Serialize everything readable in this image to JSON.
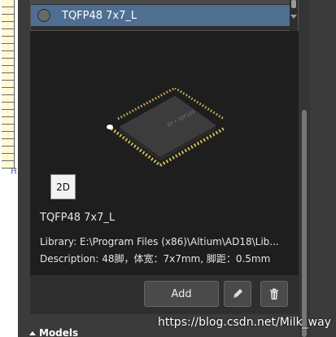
{
  "component_list": {
    "selected_item": "TQFP48 7x7_L"
  },
  "preview": {
    "view_mode_button": "2D",
    "component_name": "TQFP48 7x7_L",
    "library_line": "Library: E:\\Program Files (x86)\\Altium\\AD18\\Lib...",
    "description_line": "Description: 48脚，体宽：7x7mm, 脚距：0.5mm",
    "chip_marking": "ST • 32F103"
  },
  "toolbar": {
    "add_label": "Add",
    "edit_icon": "pencil-icon",
    "delete_icon": "trash-icon"
  },
  "sections": {
    "models_label": "Models"
  },
  "watermark": "https://blog.csdn.net/Milk_way",
  "colors": {
    "panel_bg": "#3b3b3b",
    "preview_bg": "#1e1e1e",
    "selection": "#4f6f92",
    "pin_gold": "#c8b24a"
  }
}
